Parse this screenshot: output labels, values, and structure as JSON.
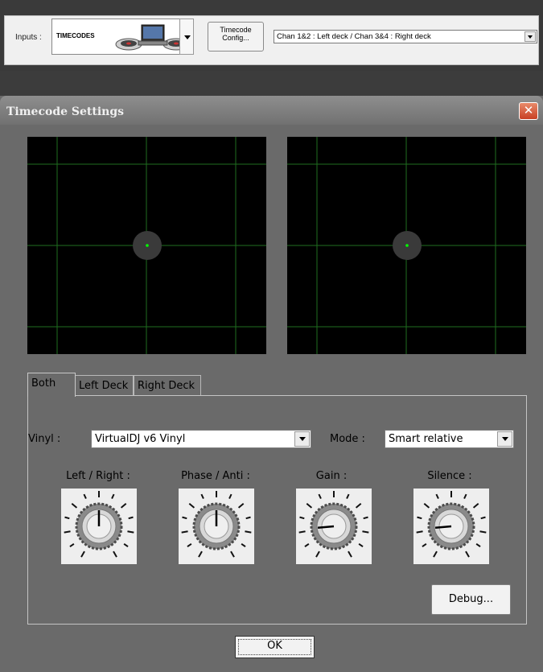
{
  "inputs_bar": {
    "label": "Inputs :",
    "device": "TIMECODES",
    "config_button_line1": "Timecode",
    "config_button_line2": "Config...",
    "channel_routing": "Chan 1&2 : Left deck / Chan 3&4 : Right deck"
  },
  "dialog": {
    "title": "Timecode Settings",
    "close_glyph": "✕",
    "tabs": [
      {
        "label": "Both",
        "active": true
      },
      {
        "label": "Left Deck",
        "active": false
      },
      {
        "label": "Right Deck",
        "active": false
      }
    ],
    "vinyl_label": "Vinyl :",
    "vinyl_value": "VirtualDJ v6 Vinyl",
    "mode_label": "Mode :",
    "mode_value": "Smart relative",
    "knobs": [
      {
        "label": "Left / Right :",
        "angle_deg": 0
      },
      {
        "label": "Phase / Anti :",
        "angle_deg": 0
      },
      {
        "label": "Gain :",
        "angle_deg": -95
      },
      {
        "label": "Silence :",
        "angle_deg": -95
      }
    ],
    "debug_label": "Debug...",
    "ok_label": "OK"
  },
  "colors": {
    "scope_bg": "#000000",
    "scope_grid": "#1f7a1f",
    "scope_dot": "#00ff00",
    "close_red": "#c84024"
  },
  "icons": {
    "close": "close-icon",
    "dropdown": "chevron-down-icon",
    "knob": "knob-icon",
    "turntables": "turntables-laptop-icon"
  }
}
